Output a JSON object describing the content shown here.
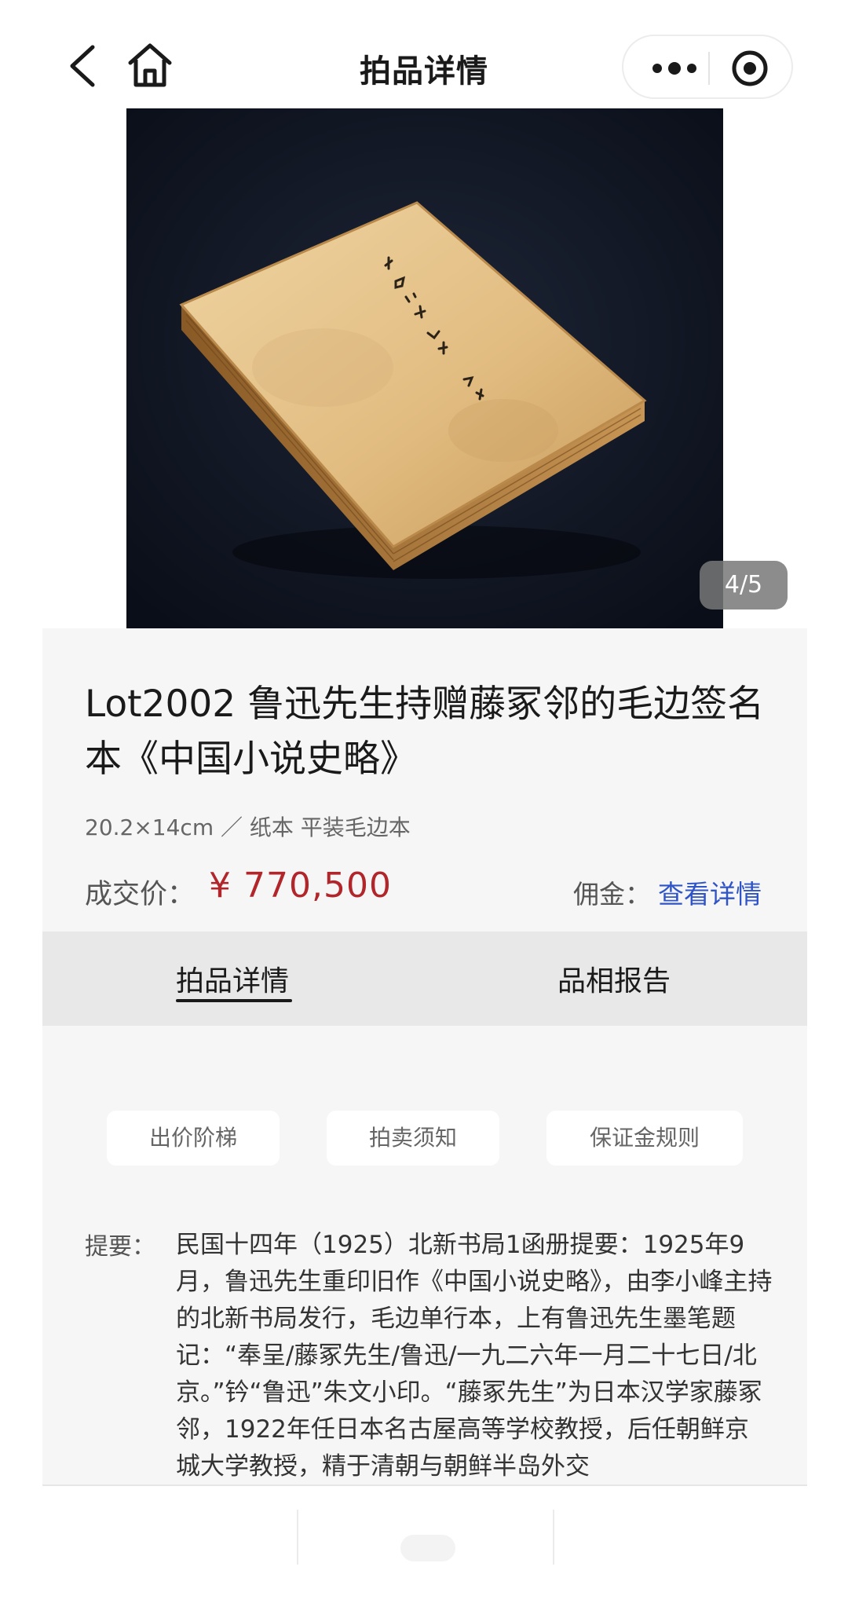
{
  "nav": {
    "title": "拍品详情",
    "back_icon": "chevron-left-icon",
    "home_icon": "home-icon",
    "more_icon": "more-dots-icon",
    "target_icon": "record-target-icon"
  },
  "gallery": {
    "counter": "4/5",
    "current": 4,
    "total": 5
  },
  "lot": {
    "title": "Lot2002 鲁迅先生持赠藤冢邻的毛边签名本《中国小说史略》",
    "spec": "20.2×14cm ／ 纸本 平装毛边本",
    "price_label": "成交价：",
    "price_value": "¥ 770,500",
    "commission_label": "佣金：",
    "commission_link": "查看详情"
  },
  "tabs": [
    {
      "label": "拍品详情",
      "active": true
    },
    {
      "label": "品相报告",
      "active": false
    }
  ],
  "pills": [
    {
      "label": "出价阶梯"
    },
    {
      "label": "拍卖须知"
    },
    {
      "label": "保证金规则"
    }
  ],
  "summary": {
    "label": "提要：",
    "text": "民国十四年（1925）北新书局1函册提要：1925年9月，鲁迅先生重印旧作《中国小说史略》，由李小峰主持的北新书局发行，毛边单行本，上有鲁迅先生墨笔题记：“奉呈/藤冢先生/鲁迅/一九二六年一月二十七日/北京。”钤“鲁迅”朱文小印。“藤冢先生”为日本汉学家藤冢邻，1922年任日本名古屋高等学校教授，后任朝鲜京城大学教授，精于清朝与朝鲜半岛外交"
  },
  "colors": {
    "price": "#b0262a",
    "link": "#2f54c7",
    "panel_bg": "#f6f6f6",
    "tab_bar_bg": "#e8e8e8"
  }
}
